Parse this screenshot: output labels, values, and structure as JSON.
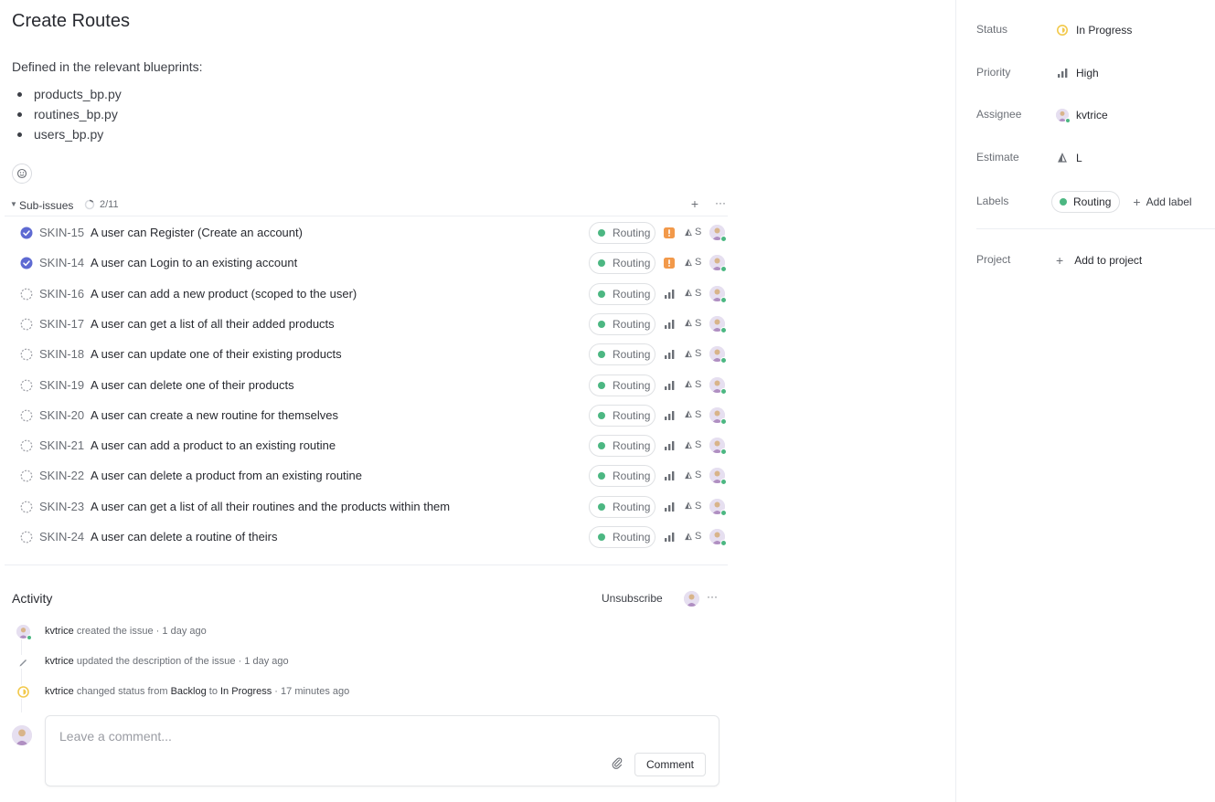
{
  "issue": {
    "title": "Create Routes",
    "description_intro": "Defined in the relevant blueprints:",
    "bullets": [
      "products_bp.py",
      "routines_bp.py",
      "users_bp.py"
    ]
  },
  "subissues": {
    "label": "Sub-issues",
    "count": "2/11",
    "rows": [
      {
        "key": "SKIN-15",
        "title": "A user can Register (Create an account)",
        "label": "Routing",
        "estimate": "S",
        "done": true,
        "urgent": true
      },
      {
        "key": "SKIN-14",
        "title": "A user can Login to an existing account",
        "label": "Routing",
        "estimate": "S",
        "done": true,
        "urgent": true
      },
      {
        "key": "SKIN-16",
        "title": "A user can add a new product (scoped to the user)",
        "label": "Routing",
        "estimate": "S",
        "done": false,
        "urgent": false
      },
      {
        "key": "SKIN-17",
        "title": "A user can get a list of all their added products",
        "label": "Routing",
        "estimate": "S",
        "done": false,
        "urgent": false
      },
      {
        "key": "SKIN-18",
        "title": "A user can update one of their existing products",
        "label": "Routing",
        "estimate": "S",
        "done": false,
        "urgent": false
      },
      {
        "key": "SKIN-19",
        "title": "A user can delete one of their products",
        "label": "Routing",
        "estimate": "S",
        "done": false,
        "urgent": false
      },
      {
        "key": "SKIN-20",
        "title": "A user can create a new routine for themselves",
        "label": "Routing",
        "estimate": "S",
        "done": false,
        "urgent": false
      },
      {
        "key": "SKIN-21",
        "title": "A user can add a product to an existing routine",
        "label": "Routing",
        "estimate": "S",
        "done": false,
        "urgent": false
      },
      {
        "key": "SKIN-22",
        "title": "A user can delete a product from an existing routine",
        "label": "Routing",
        "estimate": "S",
        "done": false,
        "urgent": false
      },
      {
        "key": "SKIN-23",
        "title": "A user can get a list of all their routines and the products within them",
        "label": "Routing",
        "estimate": "S",
        "done": false,
        "urgent": false
      },
      {
        "key": "SKIN-24",
        "title": "A user can delete a routine of theirs",
        "label": "Routing",
        "estimate": "S",
        "done": false,
        "urgent": false
      }
    ]
  },
  "activity": {
    "title": "Activity",
    "unsubscribe_label": "Unsubscribe",
    "events": [
      {
        "actor": "kvtrice",
        "text": " created the issue",
        "sep": " · ",
        "time": "1 day ago"
      },
      {
        "actor": "kvtrice",
        "text": " updated the description of the issue",
        "sep": " · ",
        "time": "1 day ago"
      },
      {
        "actor": "kvtrice",
        "text": " changed status from ",
        "from": "Backlog",
        "to_word": " to ",
        "to": "In Progress",
        "sep": " · ",
        "time": "17 minutes ago"
      }
    ],
    "comment_placeholder": "Leave a comment...",
    "comment_button": "Comment"
  },
  "properties": {
    "status_label": "Status",
    "status_value": "In Progress",
    "priority_label": "Priority",
    "priority_value": "High",
    "assignee_label": "Assignee",
    "assignee_value": "kvtrice",
    "estimate_label": "Estimate",
    "estimate_value": "L",
    "labels_label": "Labels",
    "label_value": "Routing",
    "add_label": "Add label",
    "project_label": "Project",
    "add_project": "Add to project"
  },
  "colors": {
    "label_green": "#4cb782",
    "done_blue": "#5e6ad2",
    "urgent_orange": "#f2994a",
    "in_progress_yellow": "#f2c94c"
  },
  "icons": {
    "emoji_reaction": "add-reaction-icon",
    "sub_issues_progress": "progress-ring-icon",
    "status_done": "check-circle-icon",
    "status_todo": "dashed-circle-icon",
    "priority_urgent": "urgent-icon",
    "priority_high": "signal-bars-icon",
    "estimate": "triangle-estimate-icon",
    "attach": "paperclip-icon",
    "edit": "pencil-icon"
  }
}
